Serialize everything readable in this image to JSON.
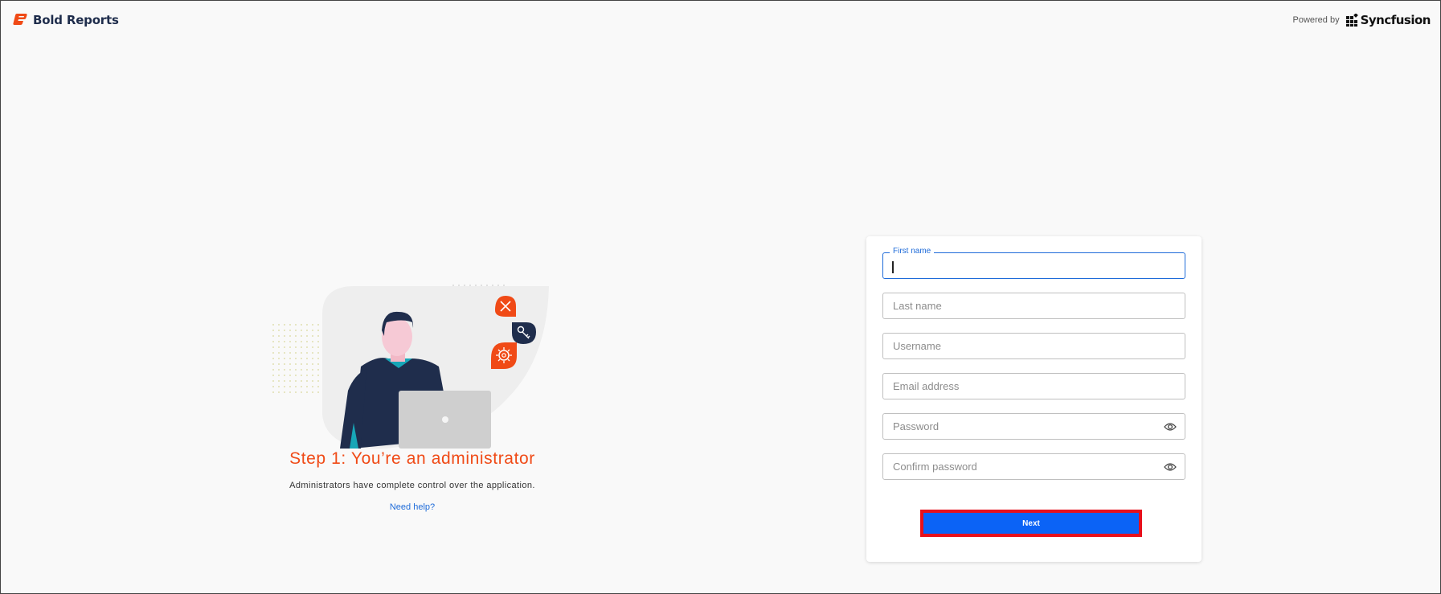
{
  "header": {
    "brand_name": "Bold Reports",
    "brand_icon": "bold-reports-logo-icon",
    "powered_by_label": "Powered by",
    "partner_name": "Syncfusion",
    "partner_icon": "syncfusion-logo-icon"
  },
  "hero": {
    "title": "Step 1: You’re an administrator",
    "description": "Administrators have complete control over the application.",
    "help_link": "Need help?",
    "icons": [
      "tools-icon",
      "key-icon",
      "settings-icon"
    ]
  },
  "form": {
    "first_name_label": "First name",
    "first_name_value": "",
    "last_name_placeholder": "Last name",
    "username_placeholder": "Username",
    "email_placeholder": "Email address",
    "password_placeholder": "Password",
    "confirm_password_placeholder": "Confirm password",
    "next_label": "Next"
  },
  "colors": {
    "accent_orange": "#f04a16",
    "primary_blue": "#0b63f6",
    "focus_blue": "#1e6bd9",
    "highlight_red": "#e8101b",
    "navy": "#1f2d4c"
  }
}
